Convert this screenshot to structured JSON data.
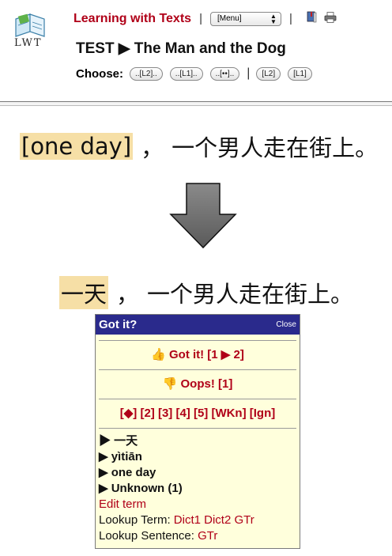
{
  "header": {
    "app_title": "Learning with Texts",
    "logo_text": "LWT",
    "menu_select": "[Menu]",
    "text_title": "TEST ▶ The Man and the Dog",
    "choose_label": "Choose:",
    "choose_buttons": [
      "..[L2]..",
      "..[L1]..",
      "..[••]..",
      "[L2]",
      "[L1]"
    ]
  },
  "illustration": {
    "sentence_before": {
      "highlight": "[one day]",
      "punct": "，",
      "rest": "一个男人走在街上。"
    },
    "sentence_after": {
      "highlight": "一天",
      "punct": "，",
      "rest": "一个男人走在街上。"
    }
  },
  "popup": {
    "title": "Got it?",
    "close": "Close",
    "got_it": "Got it! [1 ▶ 2]",
    "oops": "Oops! [1]",
    "status_options": "[◆] [2] [3] [4] [5] [WKn] [Ign]",
    "term": "▶ 一天",
    "romanization": "▶ yìtiān",
    "translation": "▶ one day",
    "status": "▶ Unknown (1)",
    "edit_term": "Edit term",
    "lookup_term_label": "Lookup Term:",
    "lookup_term_links": [
      "Dict1",
      "Dict2",
      "GTr"
    ],
    "lookup_sentence_label": "Lookup Sentence:",
    "lookup_sentence_links": [
      "GTr"
    ]
  },
  "colors": {
    "accent_red": "#b00018",
    "highlight": "#f6dfa6",
    "popup_header": "#2a2a8c",
    "popup_bg": "#ffffdc"
  }
}
